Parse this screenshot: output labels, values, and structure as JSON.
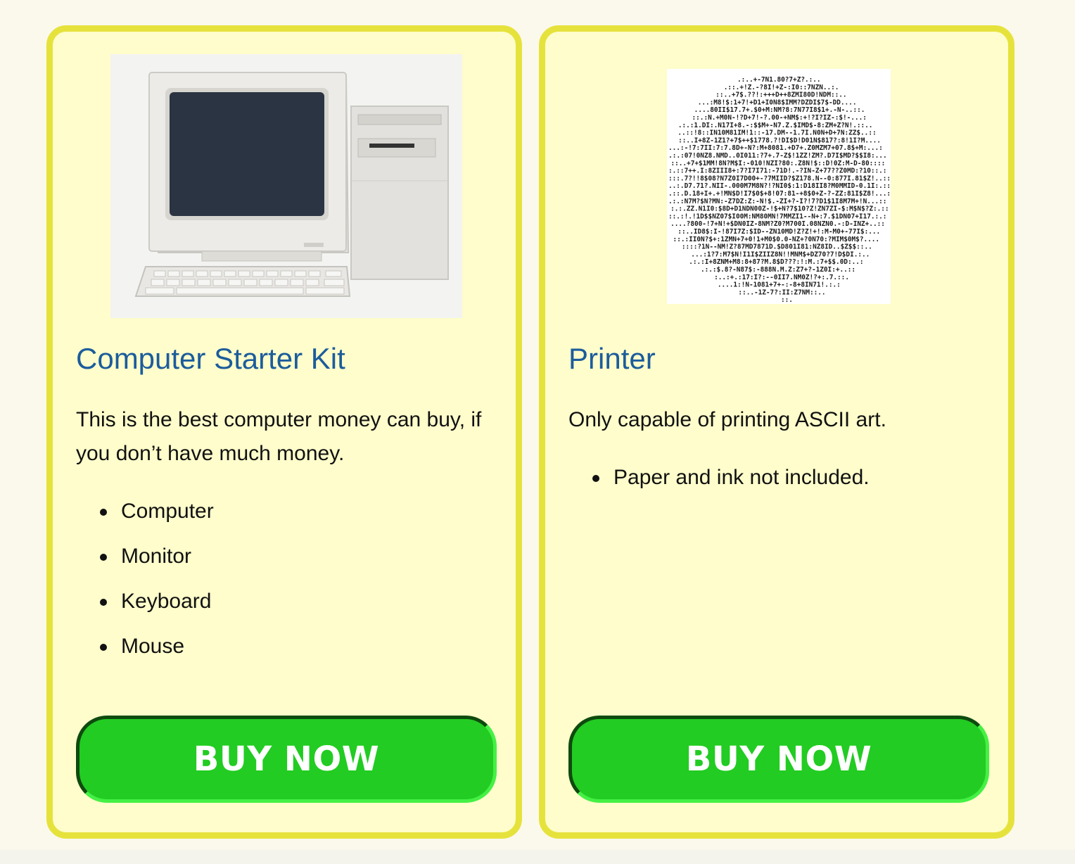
{
  "products": [
    {
      "title": "Computer Starter Kit",
      "description": "This is the best computer money can buy, if you don’t have much money.",
      "features": [
        "Computer",
        "Monitor",
        "Keyboard",
        "Mouse"
      ],
      "button_label": "BUY NOW",
      "image_subject": "beige-desktop-computer"
    },
    {
      "title": "Printer",
      "description": "Only capable of printing ASCII art.",
      "features": [
        "Paper and ink not included."
      ],
      "button_label": "BUY NOW",
      "image_subject": "ascii-art-printout"
    }
  ],
  "colors": {
    "page_background": "#fbf9ec",
    "card_background": "#fefdcb",
    "card_border": "#e6e23c",
    "title": "#1c5c9c",
    "button": "#22cc22"
  }
}
